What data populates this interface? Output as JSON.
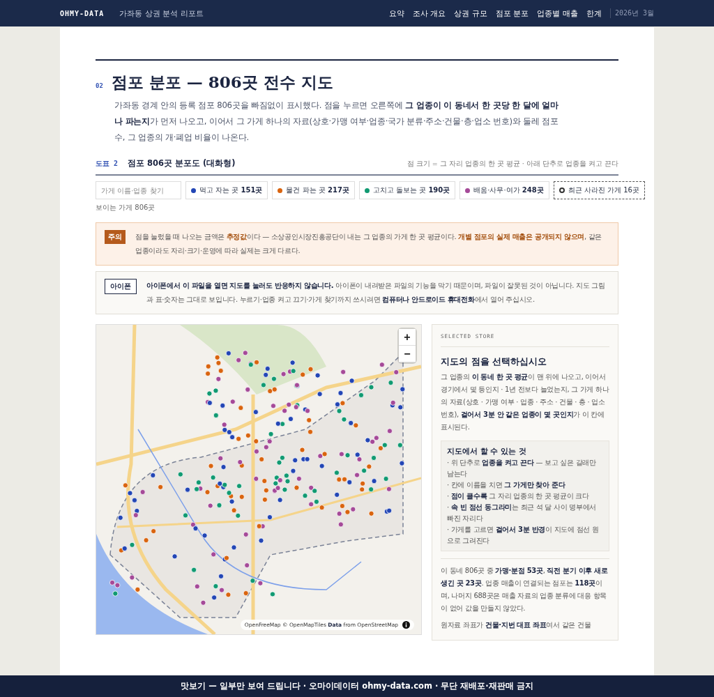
{
  "header": {
    "brand": "OHMY-DATA",
    "subtitle": "가좌동 상권 분석 리포트",
    "nav": [
      "요약",
      "조사 개요",
      "상권 규모",
      "점포 분포",
      "업종별 매출",
      "한계"
    ],
    "date": "2026년 3월"
  },
  "section": {
    "number": "02",
    "title": "점포 분포 — 806곳 전수 지도",
    "intro": "가좌동 경계 안의 등록 점포 806곳을 빠짐없이 표시했다. 점을 누르면 오른쪽에 **그 업종이 이 동네서 한 곳당 한 달에 얼마나 파는지**가 먼저 나오고, 이어서 그 가게 하나의 자료(상호·가맹 여부·업종·국가 분류·주소·건물·층·업소 번호)와 둘레 점포 수, 그 업종의 개·폐업 비율이 나온다."
  },
  "figure": {
    "label": "도표 2",
    "title": "점포 806곳 분포도 (대화형)",
    "note": "점 크기 = 그 자리 업종의 한 곳 평균 · 아래 단추로 업종을 켜고 끈다"
  },
  "search": {
    "placeholder": "가게 이름·업종 찾기"
  },
  "filters": [
    {
      "kind": "dot",
      "label": "먹고 자는 곳 **151곳**",
      "color": "#2346b5"
    },
    {
      "kind": "dot",
      "label": "물건 파는 곳 **217곳**",
      "color": "#d9640f"
    },
    {
      "kind": "dot",
      "label": "고치고 돌보는 곳 **190곳**",
      "color": "#119a72"
    },
    {
      "kind": "dot",
      "label": "배움·사무·여가 **248곳**",
      "color": "#a54a98"
    },
    {
      "kind": "ring",
      "label": "최근 사라진 가게 16곳",
      "color": "#333333"
    }
  ],
  "visible_count": "보이는 가게 806곳",
  "notices": [
    {
      "kind": "warning",
      "tag": "주의",
      "text": "점을 눌렀을 때 나오는 금액은 **추정값**이다 — 소상공인시장진흥공단이 내는 그 업종의 가게 한 곳 평균이다. **개별 점포의 실제 매출은 공개되지 않으며**, 같은 업종이라도 자리·크기·운영에 따라 실제는 크게 다르다."
    },
    {
      "kind": "info",
      "tag": "아이폰",
      "text": "**아이폰에서 이 파일을 열면 지도를 눌러도 반응하지 않습니다.** 아이폰이 내려받은 파일의 기능을 막기 때문이며, 파일이 잘못된 것이 아닙니다. 지도 그림과 표·숫자는 그대로 보입니다. 누르기·업종 켜고 끄기·가게 찾기까지 쓰시려면 **컴퓨터나 안드로이드 휴대전화**에서 열어 주십시오."
    }
  ],
  "map": {
    "zoom_buttons": [
      "+",
      "−"
    ],
    "attribution": "OpenFreeMap © OpenMapTiles **Data** from OpenStreetMap"
  },
  "panel": {
    "eyebrow": "SELECTED STORE",
    "heading": "지도의 점을 선택하십시오",
    "body": "그 업종의 **이 동네 한 곳 평균**이 맨 위에 나오고, 이어서 경기에서 몇 등인지 · 1년 전보다 늘었는지, 그 가게 하나의 자료(상호 · 가맹 여부 · 업종 · 주소 · 건물 · 층 · 업소번호), **걸어서 3분 안 같은 업종이 몇 곳인지**가 이 칸에 표시된다.",
    "howto": {
      "title": "지도에서 할 수 있는 것",
      "items": [
        "· 위 단추로 **업종을 켜고 끈다** — 보고 싶은 갈래만 남는다",
        "· 칸에 이름을 치면 **그 가게만 찾아 준다**",
        "· **점이 클수록** 그 자리 업종의 한 곳 평균이 크다",
        "· **속 빈 점선 동그라미**는 최근 석 달 사이 명부에서 빠진 자리다",
        "· 가게를 고르면 **걸어서 3분 반경**이 지도에 점선 원으로 그려진다"
      ]
    },
    "stats": [
      "이 동네 806곳 중 **가맹·분점 53곳**, **직전 분기 이후 새로 생긴 곳 23곳**. 업종 매출이 연결되는 점포는 **118곳**이며, 나머지 688곳은 매출 자료의 업종 분류에 대응 항목이 없어 값을 만들지 않았다.",
      "원자료 좌표가 **건물·지번 대표 좌표**여서 같은 건물"
    ]
  },
  "footer": "맛보기 — 일부만 보여 드립니다 · 오마이데이터 ohmy-data.com · 무단 재배포·재판매 금지"
}
